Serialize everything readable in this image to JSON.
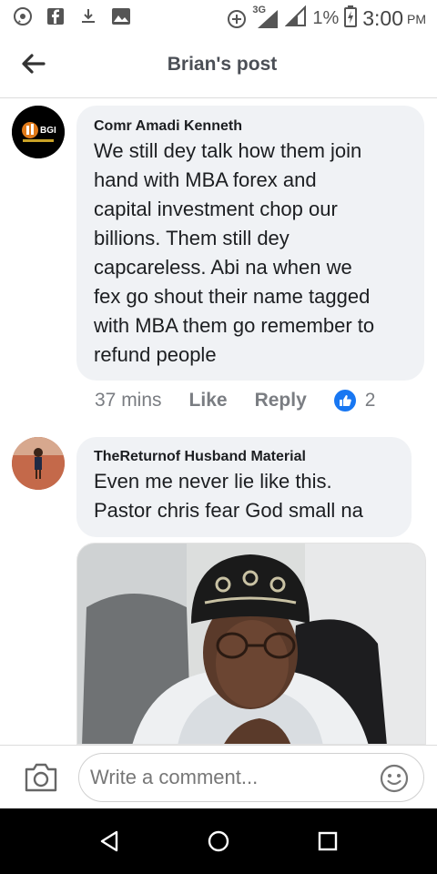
{
  "status_bar": {
    "network": "3G",
    "battery": "1%",
    "time": "3:00",
    "ampm": "PM"
  },
  "header": {
    "title": "Brian's post"
  },
  "comments": [
    {
      "author": "Comr Amadi Kenneth",
      "text": "We still dey talk how them join\nhand with MBA forex and\ncapital investment chop our\nbillions.     Them still dey\ncapcareless.  Abi na when we\nfex go shout their name tagged\nwith MBA them go remember to\nrefund people",
      "time": "37 mins",
      "like_label": "Like",
      "reply_label": "Reply",
      "reaction_count": "2",
      "avatar_text": "BGI"
    },
    {
      "author": "TheReturnof Husband Material",
      "text": "Even me never lie like this.\nPastor chris fear God small na"
    }
  ],
  "composer": {
    "placeholder": "Write a comment..."
  },
  "colors": {
    "like_blue": "#1877f2",
    "bubble_bg": "#f0f2f5",
    "meta_gray": "#7a7d82"
  }
}
